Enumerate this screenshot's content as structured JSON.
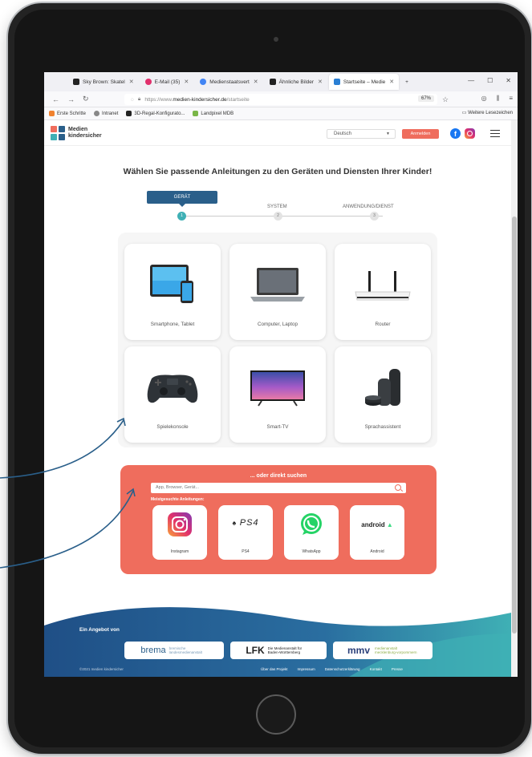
{
  "browser": {
    "tabs": [
      {
        "label": "Sky Brown: Skatel",
        "color": "#222222",
        "active": false
      },
      {
        "label": "E-Mail (35)",
        "color": "#e1306c",
        "active": false
      },
      {
        "label": "Medienstaatsvert",
        "color": "#4285f4",
        "active": false
      },
      {
        "label": "Ähnliche Bilder",
        "color": "#222222",
        "active": false
      },
      {
        "label": "Startseite – Medie",
        "color": "#2a7fd4",
        "active": true
      }
    ],
    "new_tab": "+",
    "url_prefix": "https://www.",
    "url_domain": "medien-kindersicher.de",
    "url_path": "/startseite",
    "zoom": "67%",
    "bookmarks": [
      {
        "label": "Erste Schritte",
        "color": "#f0822f"
      },
      {
        "label": "Intranet",
        "color": "#888888"
      },
      {
        "label": "3D-Regal-Konfigurato...",
        "color": "#222222"
      },
      {
        "label": "Landpixel MDB",
        "color": "#7ab648"
      }
    ],
    "bookmarks_right": "Weitere Lesezeichen"
  },
  "header": {
    "logo_line1": "Medien",
    "logo_line2": "kindersicher",
    "language": "Deutsch",
    "login_label": "Anmelden"
  },
  "main": {
    "heading": "Wählen Sie passende Anleitungen zu den Geräten und Diensten Ihrer Kinder!",
    "steps": [
      {
        "label": "GERÄT",
        "number": "1"
      },
      {
        "label": "SYSTEM",
        "number": "2"
      },
      {
        "label": "ANWENDUNG/DIENST",
        "number": "3"
      }
    ],
    "devices": [
      {
        "label": "Smartphone, Tablet",
        "icon": "tablet-phone-icon"
      },
      {
        "label": "Computer, Laptop",
        "icon": "laptop-icon"
      },
      {
        "label": "Router",
        "icon": "router-icon"
      },
      {
        "label": "Spielekonsole",
        "icon": "gamepad-icon"
      },
      {
        "label": "Smart-TV",
        "icon": "tv-icon"
      },
      {
        "label": "Sprachassistent",
        "icon": "smart-speaker-icon"
      }
    ]
  },
  "search": {
    "title": "... oder direkt suchen",
    "placeholder": "App, Browser, Gerät...",
    "popular_label": "Meistgesuchte Anleitungen:",
    "apps": [
      {
        "label": "Instagram",
        "icon": "instagram-icon"
      },
      {
        "label": "PS4",
        "icon": "ps4-logo-icon",
        "logo_text": "PS4"
      },
      {
        "label": "WhatsApp",
        "icon": "whatsapp-icon"
      },
      {
        "label": "Android",
        "icon": "android-logo-icon",
        "logo_text": "android"
      }
    ]
  },
  "footer": {
    "heading": "Ein Angebot von",
    "partners": [
      {
        "label": "bremische landesmedienanstalt",
        "mark": "brema"
      },
      {
        "label": "Die Medienanstalt für Baden-Württemberg",
        "mark": "LFK"
      },
      {
        "label": "medienanstalt mecklenburg-vorpommern",
        "mark": "mmv"
      }
    ],
    "copyright": "©2021 medien kindersicher",
    "links": [
      "Über das Projekt",
      "Impressum",
      "Datenschutzerklärung",
      "Kontakt",
      "Presse"
    ]
  },
  "colors": {
    "accent": "#ef6d5d",
    "step_active": "#2a5f8a",
    "step_dot": "#3fb0b5",
    "arrow": "#2a5f8a"
  }
}
